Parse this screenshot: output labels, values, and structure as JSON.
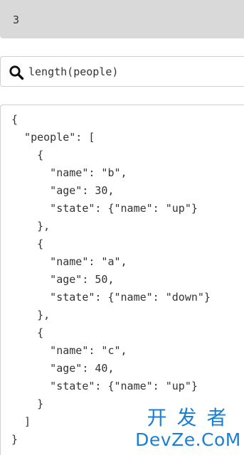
{
  "result": {
    "value": "3"
  },
  "query": {
    "value": "length(people)",
    "icon": "search-icon"
  },
  "json_editor": {
    "lines": [
      "{",
      "  \"people\": [",
      "    {",
      "      \"name\": \"b\",",
      "      \"age\": 30,",
      "      \"state\": {\"name\": \"up\"}",
      "    },",
      "    {",
      "      \"name\": \"a\",",
      "      \"age\": 50,",
      "      \"state\": {\"name\": \"down\"}",
      "    },",
      "    {",
      "      \"name\": \"c\",",
      "      \"age\": 40,",
      "      \"state\": {\"name\": \"up\"}",
      "    }",
      "  ]",
      "}"
    ]
  },
  "watermark": {
    "top": "开发者",
    "bottom": "DevZe.CoM",
    "color": "#1a7fd6"
  }
}
